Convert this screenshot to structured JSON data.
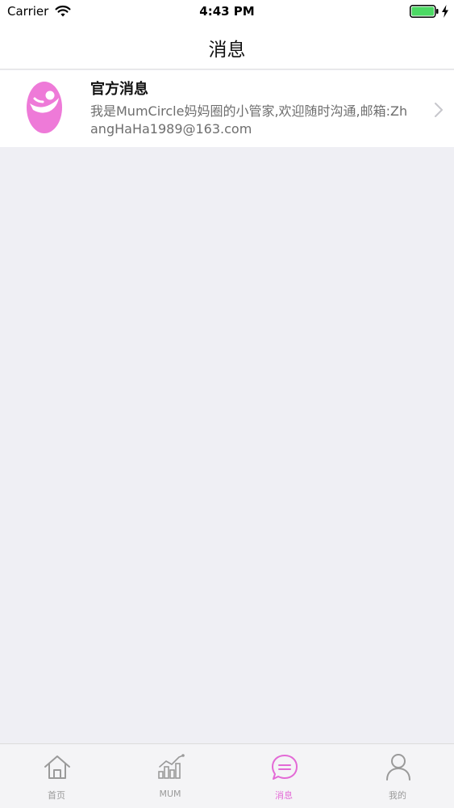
{
  "status_bar": {
    "carrier": "Carrier",
    "time": "4:43 PM",
    "battery_color": "#4cd964"
  },
  "nav": {
    "title": "消息"
  },
  "messages": [
    {
      "title": "官方消息",
      "preview": "我是MumCircle妈妈圈的小管家,欢迎随时沟通,邮箱:ZhangHaHa1989@163.com",
      "avatar_icon": "mom-baby-logo-icon",
      "avatar_color": "#ee7ad8"
    }
  ],
  "tab_bar": {
    "active_color": "#e36ad6",
    "inactive_color": "#9a9a9a",
    "items": [
      {
        "label": "首页",
        "icon": "home-icon",
        "active": false
      },
      {
        "label": "MUM",
        "icon": "chart-icon",
        "active": false
      },
      {
        "label": "消息",
        "icon": "chat-bubble-icon",
        "active": true
      },
      {
        "label": "我的",
        "icon": "person-icon",
        "active": false
      }
    ]
  }
}
